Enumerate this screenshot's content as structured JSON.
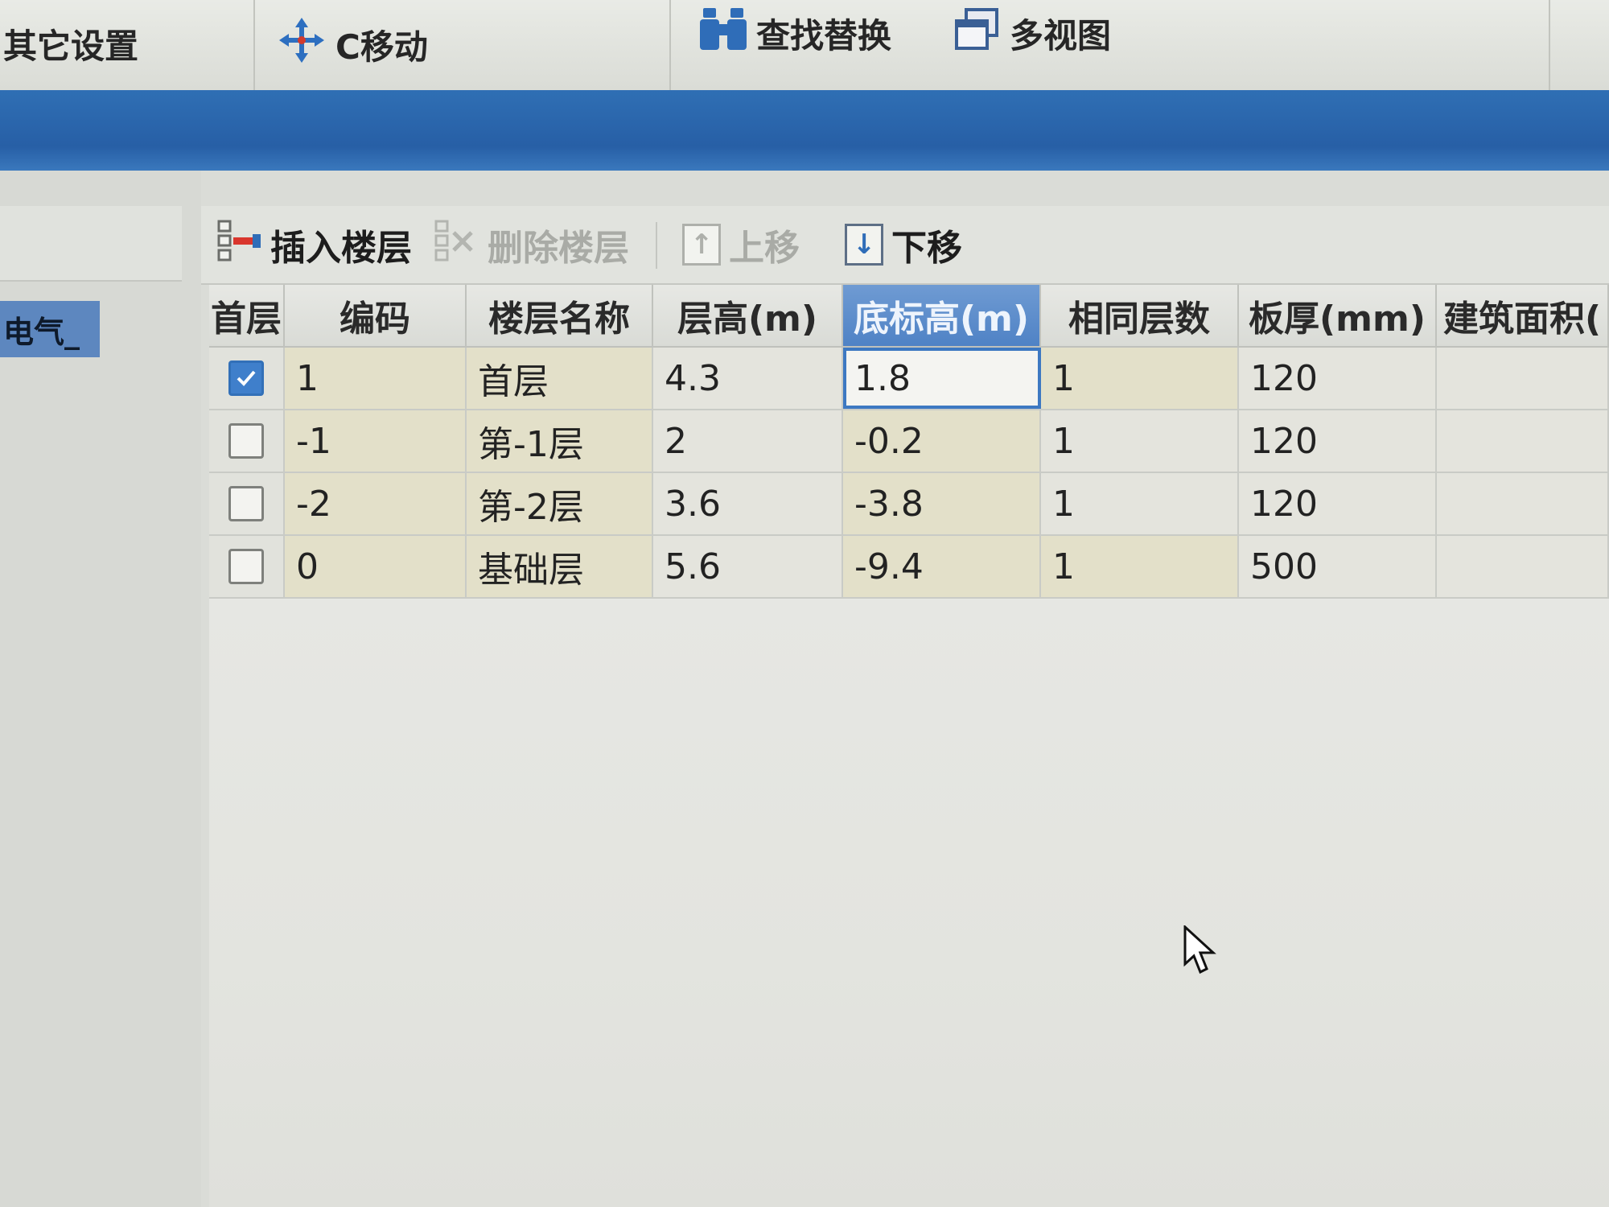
{
  "ribbon": {
    "other_settings": "其它设置",
    "move": "C移动",
    "find_replace": "查找替换",
    "multi_view": "多视图"
  },
  "left_pane": {
    "node_label": "电气_"
  },
  "floor_toolbar": {
    "insert_floor": "插入楼层",
    "delete_floor": "删除楼层",
    "move_up": "上移",
    "move_down": "下移"
  },
  "grid": {
    "columns": [
      "首层",
      "编码",
      "楼层名称",
      "层高(m)",
      "底标高(m)",
      "相同层数",
      "板厚(mm)",
      "建筑面积("
    ],
    "rows": [
      {
        "is_first": true,
        "code": "1",
        "name": "首层",
        "height": "4.3",
        "bottom_elev": "1.8",
        "same_count": "1",
        "slab": "120",
        "area": ""
      },
      {
        "is_first": false,
        "code": "-1",
        "name": "第-1层",
        "height": "2",
        "bottom_elev": "-0.2",
        "same_count": "1",
        "slab": "120",
        "area": ""
      },
      {
        "is_first": false,
        "code": "-2",
        "name": "第-2层",
        "height": "3.6",
        "bottom_elev": "-3.8",
        "same_count": "1",
        "slab": "120",
        "area": ""
      },
      {
        "is_first": false,
        "code": "0",
        "name": "基础层",
        "height": "5.6",
        "bottom_elev": "-9.4",
        "same_count": "1",
        "slab": "500",
        "area": ""
      }
    ]
  },
  "colors": {
    "accent_blue": "#2f6fb4",
    "selected_header": "#5b8ccb",
    "checkbox_checked": "#3f7fcb"
  }
}
